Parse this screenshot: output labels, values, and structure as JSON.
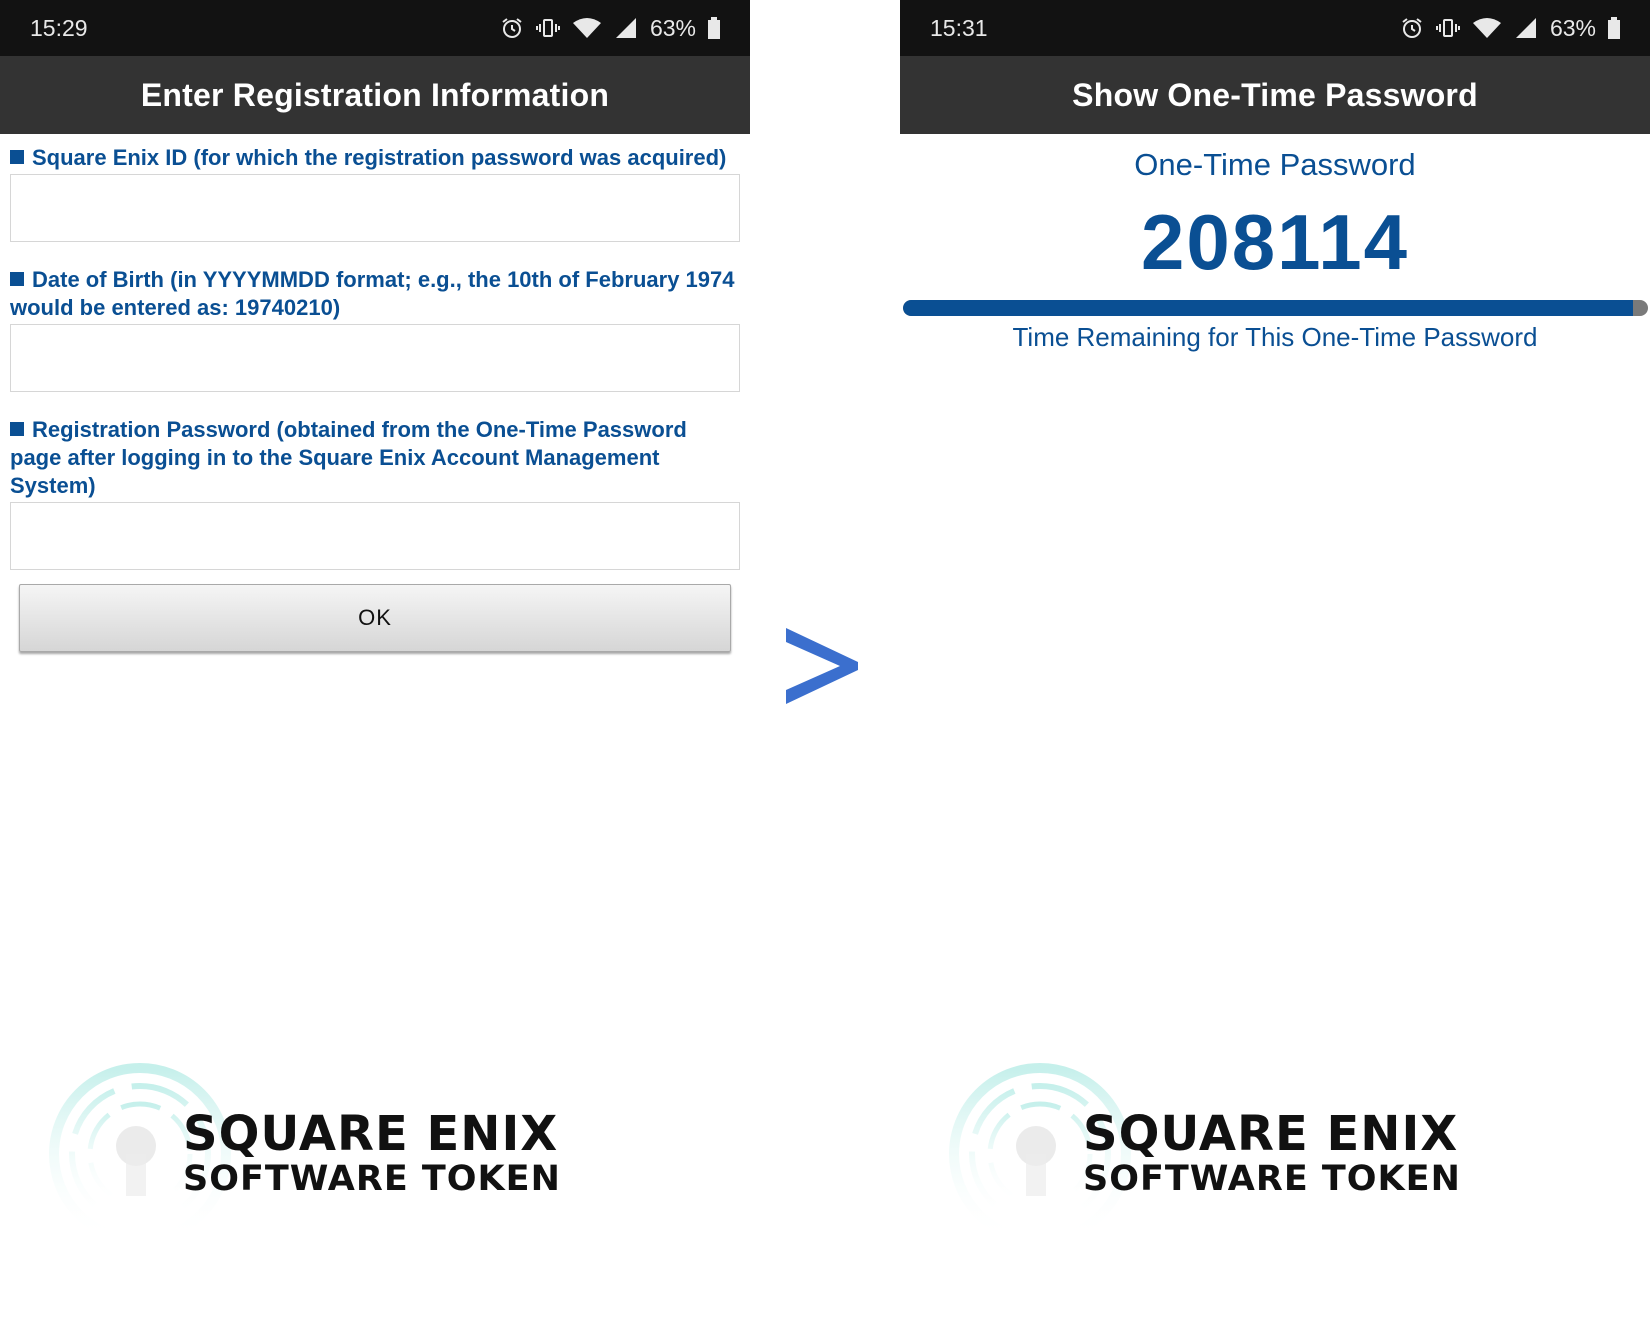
{
  "left_screen": {
    "status_bar": {
      "time": "15:29",
      "battery": "63%"
    },
    "header_title": "Enter Registration Information",
    "fields": [
      {
        "label": "Square Enix ID (for which the registration password was acquired)",
        "value": ""
      },
      {
        "label": "Date of Birth (in YYYYMMDD format; e.g., the 10th of February 1974 would be entered as: 19740210)",
        "value": ""
      },
      {
        "label": "Registration Password (obtained from the One-Time Password page after logging in to the Square Enix Account Management System)",
        "value": ""
      }
    ],
    "ok_button": "OK",
    "logo": {
      "line1": "SQUARE ENIX",
      "line2": "SOFTWARE TOKEN"
    }
  },
  "arrow_symbol": ">",
  "right_screen": {
    "status_bar": {
      "time": "15:31",
      "battery": "63%"
    },
    "header_title": "Show One-Time Password",
    "otp_title": "One-Time Password",
    "otp_code": "208114",
    "time_remaining_fraction": 0.98,
    "time_remaining_label": "Time Remaining for This One-Time Password",
    "logo": {
      "line1": "SQUARE ENIX",
      "line2": "SOFTWARE TOKEN"
    }
  },
  "colors": {
    "accent_blue": "#0a4f93",
    "header_bg": "#333333",
    "status_bg": "#121212",
    "arrow_blue": "#3b6fce",
    "logo_ring": "#bfeee9"
  },
  "icons": [
    "alarm-icon",
    "vibrate-icon",
    "wifi-icon",
    "signal-icon",
    "battery-icon",
    "chevron-right-icon",
    "key-ring-icon"
  ]
}
